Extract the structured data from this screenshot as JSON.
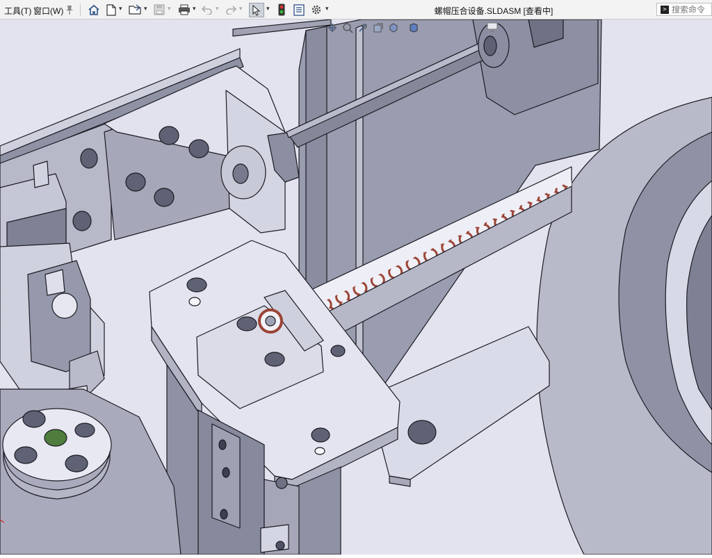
{
  "menubar": {
    "tools": "工具(T)",
    "window": "窗口(W)"
  },
  "document": {
    "title": "螺帽压合设备.SLDASM [查看中]"
  },
  "search": {
    "placeholder": "搜索命令"
  },
  "toolbar": {
    "icons": [
      "home-icon",
      "new-document-icon",
      "open-icon",
      "save-icon",
      "print-icon",
      "undo-icon",
      "redo-icon",
      "select-icon",
      "rebuild-icon",
      "file-properties-icon",
      "options-icon"
    ],
    "active": "select-icon"
  },
  "colors": {
    "part_light": "#e3e3ef",
    "part_mid": "#a4a6b6",
    "part_dark": "#777a8c",
    "edge": "#1a1a22",
    "nut_red": "#a64c3c",
    "nut_green": "#4e7d3e"
  }
}
